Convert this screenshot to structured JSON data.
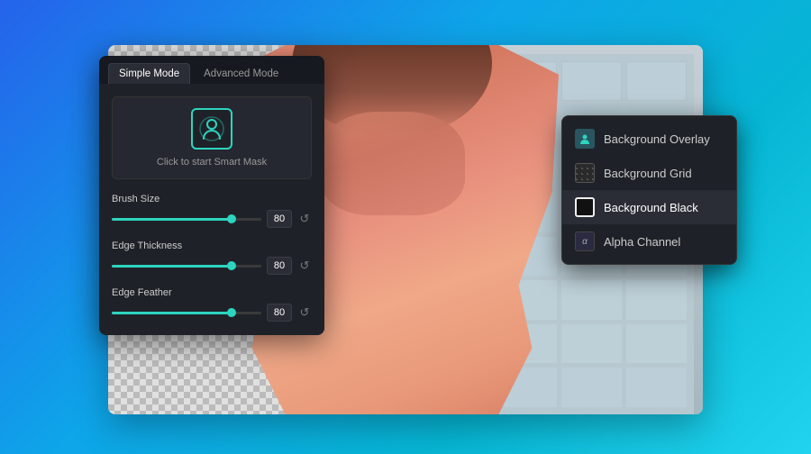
{
  "background": {
    "gradient_start": "#2563eb",
    "gradient_end": "#22d3ee"
  },
  "panel": {
    "tabs": [
      {
        "id": "simple",
        "label": "Simple Mode",
        "active": true
      },
      {
        "id": "advanced",
        "label": "Advanced Mode",
        "active": false
      }
    ],
    "smart_mask_label": "Click to start Smart Mask",
    "sliders": [
      {
        "id": "brush-size",
        "label": "Brush Size",
        "value": 80,
        "fill_percent": 80
      },
      {
        "id": "edge-thickness",
        "label": "Edge Thickness",
        "value": 80,
        "fill_percent": 80
      },
      {
        "id": "edge-feather",
        "label": "Edge Feather",
        "value": 80,
        "fill_percent": 80
      }
    ]
  },
  "dropdown": {
    "items": [
      {
        "id": "overlay",
        "label": "Background Overlay",
        "icon_type": "person",
        "selected": false
      },
      {
        "id": "grid",
        "label": "Background Grid",
        "icon_type": "grid",
        "selected": false
      },
      {
        "id": "black",
        "label": "Background Black",
        "icon_type": "black",
        "selected": true
      },
      {
        "id": "alpha",
        "label": "Alpha Channel",
        "icon_type": "alpha",
        "selected": false
      }
    ]
  }
}
